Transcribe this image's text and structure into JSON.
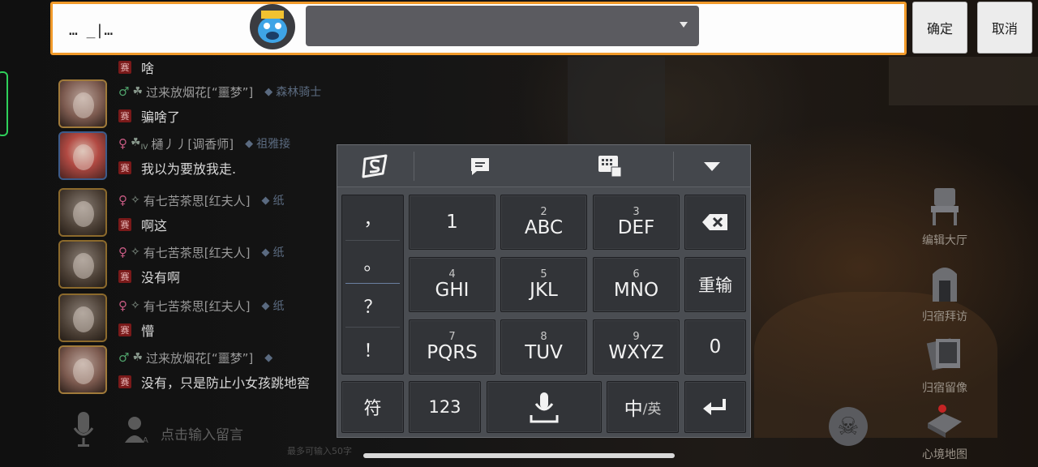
{
  "top_input": {
    "value": "… _|…",
    "confirm_label": "确定",
    "cancel_label": "取消"
  },
  "chat": {
    "messages": [
      {
        "gender": "",
        "name": "",
        "role": "",
        "text": "啥",
        "avatar": "girl"
      },
      {
        "gender": "♂",
        "name": "过来放烟花[“噩梦”]",
        "role": "森林骑士",
        "text": "骗啥了",
        "avatar": "girl"
      },
      {
        "gender": "♀",
        "name": "樋丿丿[调香师]",
        "role": "祖雅接",
        "text": "我以为要放我走.",
        "avatar": "red"
      },
      {
        "gender": "♀",
        "name": "有七苦茶思[红夫人]",
        "role": "纸",
        "text": "啊这",
        "avatar": "dark"
      },
      {
        "gender": "♀",
        "name": "有七苦茶思[红夫人]",
        "role": "纸",
        "text": "没有啊",
        "avatar": "dark"
      },
      {
        "gender": "♀",
        "name": "有七苦茶思[红夫人]",
        "role": "纸",
        "text": "懵",
        "avatar": "dark"
      },
      {
        "gender": "♂",
        "name": "过来放烟花[“噩梦”]",
        "role": "",
        "text": "没有，只是防止小女孩跳地窖",
        "avatar": "girl"
      }
    ],
    "badge_label": "赛",
    "rank_label": "IV",
    "input_placeholder": "点击输入留言",
    "input_limit": "最多可输入50字"
  },
  "side_menu": [
    {
      "label": "编辑大厅",
      "icon": "chair-icon"
    },
    {
      "label": "归宿拜访",
      "icon": "visit-icon"
    },
    {
      "label": "归宿留像",
      "icon": "photo-icon"
    },
    {
      "label": "心境地图",
      "icon": "map-icon"
    }
  ],
  "keyboard": {
    "punctuation": [
      "，",
      "。",
      "？",
      "！"
    ],
    "keys": [
      {
        "num": "",
        "letters": "1"
      },
      {
        "num": "2",
        "letters": "ABC"
      },
      {
        "num": "3",
        "letters": "DEF"
      },
      {
        "num": "4",
        "letters": "GHI"
      },
      {
        "num": "5",
        "letters": "JKL"
      },
      {
        "num": "6",
        "letters": "MNO"
      },
      {
        "num": "7",
        "letters": "PQRS"
      },
      {
        "num": "8",
        "letters": "TUV"
      },
      {
        "num": "9",
        "letters": "WXYZ"
      }
    ],
    "reenter_label": "重输",
    "zero_label": "0",
    "symbol_label": "符",
    "num_label": "123",
    "lang_main": "中",
    "lang_alt": "/英"
  },
  "colors": {
    "input_border": "#f19a2a",
    "keyboard_bg": "#4a4d52",
    "key_bg": "#323438",
    "badge_bg": "#7a1a1a"
  }
}
